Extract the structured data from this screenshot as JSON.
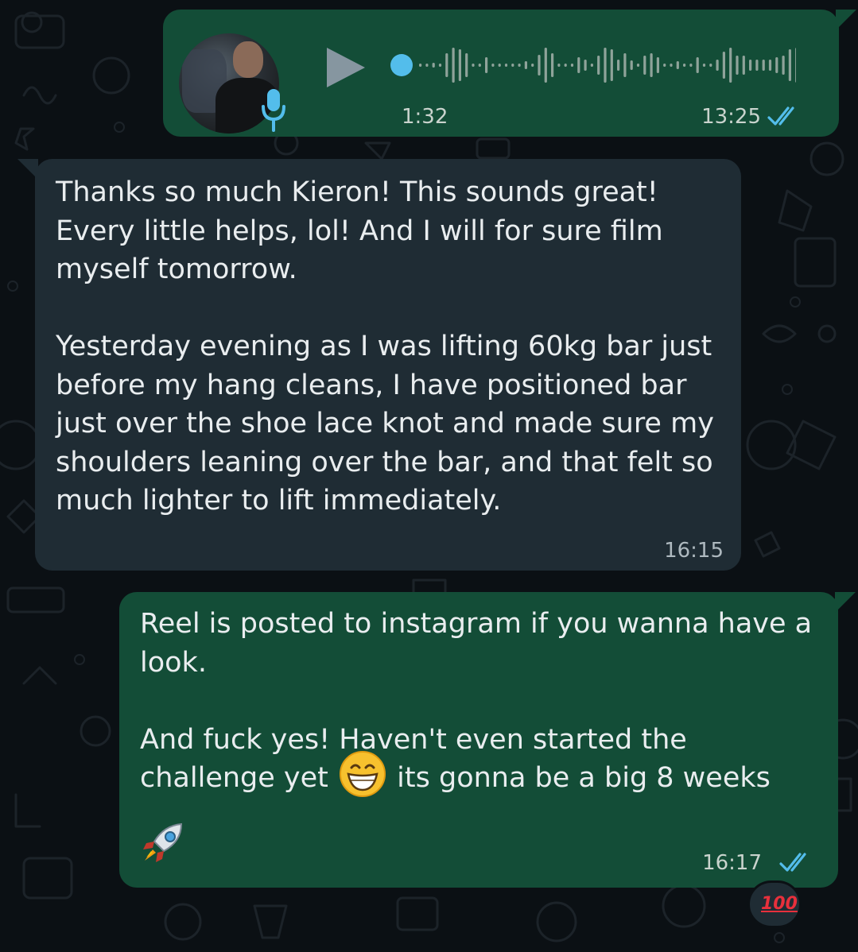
{
  "colors": {
    "background": "#0b1014",
    "outgoing_bubble": "#134d37",
    "incoming_bubble": "#1f2c34",
    "read_ticks": "#53bdeb",
    "voice_accent": "#53bdeb"
  },
  "voice_message": {
    "duration": "1:32",
    "time": "13:25",
    "status_icon": "double-check-read-icon",
    "play_icon": "play-icon",
    "mic_icon": "mic-icon"
  },
  "incoming_message": {
    "text": "Thanks so much Kieron! This sounds great! Every little helps, lol! And I will for sure film myself tomorrow.\n\nYesterday evening as I was lifting 60kg bar just before my hang cleans, I have positioned bar just over the shoe lace knot and made sure my shoulders leaning over the bar, and that felt so much lighter to lift immediately.",
    "time": "16:15"
  },
  "reply_message": {
    "paragraph1": "Reel is posted to instagram if you wanna have a look.",
    "paragraph2_before_emoji": "And fuck yes! Haven't even started the challenge yet",
    "emoji1": "grinning-face-emoji",
    "paragraph2_after_emoji": "its gonna be a big 8 weeks",
    "emoji2": "rocket-emoji",
    "time": "16:17",
    "status_icon": "double-check-read-icon",
    "reaction": "100"
  }
}
